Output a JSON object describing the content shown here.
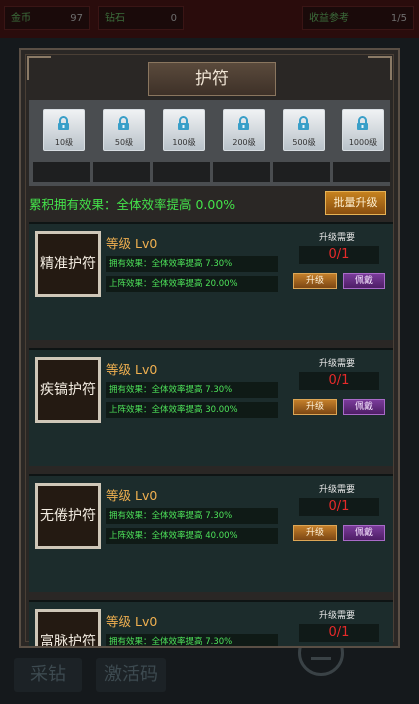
{
  "topbar": {
    "gold_label": "金币",
    "gold_value": "97",
    "gem_label": "钻石",
    "gem_value": "0",
    "income_label": "收益参考",
    "income_value": "1/5"
  },
  "bottom": {
    "mine_label": "采钻",
    "code_label": "激活码"
  },
  "modal": {
    "title": "护符",
    "tiers": [
      "10级",
      "50级",
      "100级",
      "200级",
      "500级",
      "1000级"
    ],
    "total_effect": "累积拥有效果：全体效率提高 0.00%",
    "batch_upgrade_label": "批量升级",
    "cards": [
      {
        "name": "精准护符",
        "level": "等级 Lv0",
        "own_effect": "拥有效果：全体效率提高 7.30%",
        "equip_effect": "上阵效果：全体效率提高 20.00%",
        "req_label": "升级需要",
        "req_value": "0/1",
        "upgrade": "升级",
        "equip": "佩戴"
      },
      {
        "name": "疾镐护符",
        "level": "等级 Lv0",
        "own_effect": "拥有效果：全体效率提高 7.30%",
        "equip_effect": "上阵效果：全体效率提高 30.00%",
        "req_label": "升级需要",
        "req_value": "0/1",
        "upgrade": "升级",
        "equip": "佩戴"
      },
      {
        "name": "无倦护符",
        "level": "等级 Lv0",
        "own_effect": "拥有效果：全体效率提高 7.30%",
        "equip_effect": "上阵效果：全体效率提高 40.00%",
        "req_label": "升级需要",
        "req_value": "0/1",
        "upgrade": "升级",
        "equip": "佩戴"
      },
      {
        "name": "富脉护符",
        "level": "等级 Lv0",
        "own_effect": "拥有效果：全体效率提高 7.30%",
        "req_label": "升级需要",
        "req_value": "0/1"
      }
    ]
  }
}
